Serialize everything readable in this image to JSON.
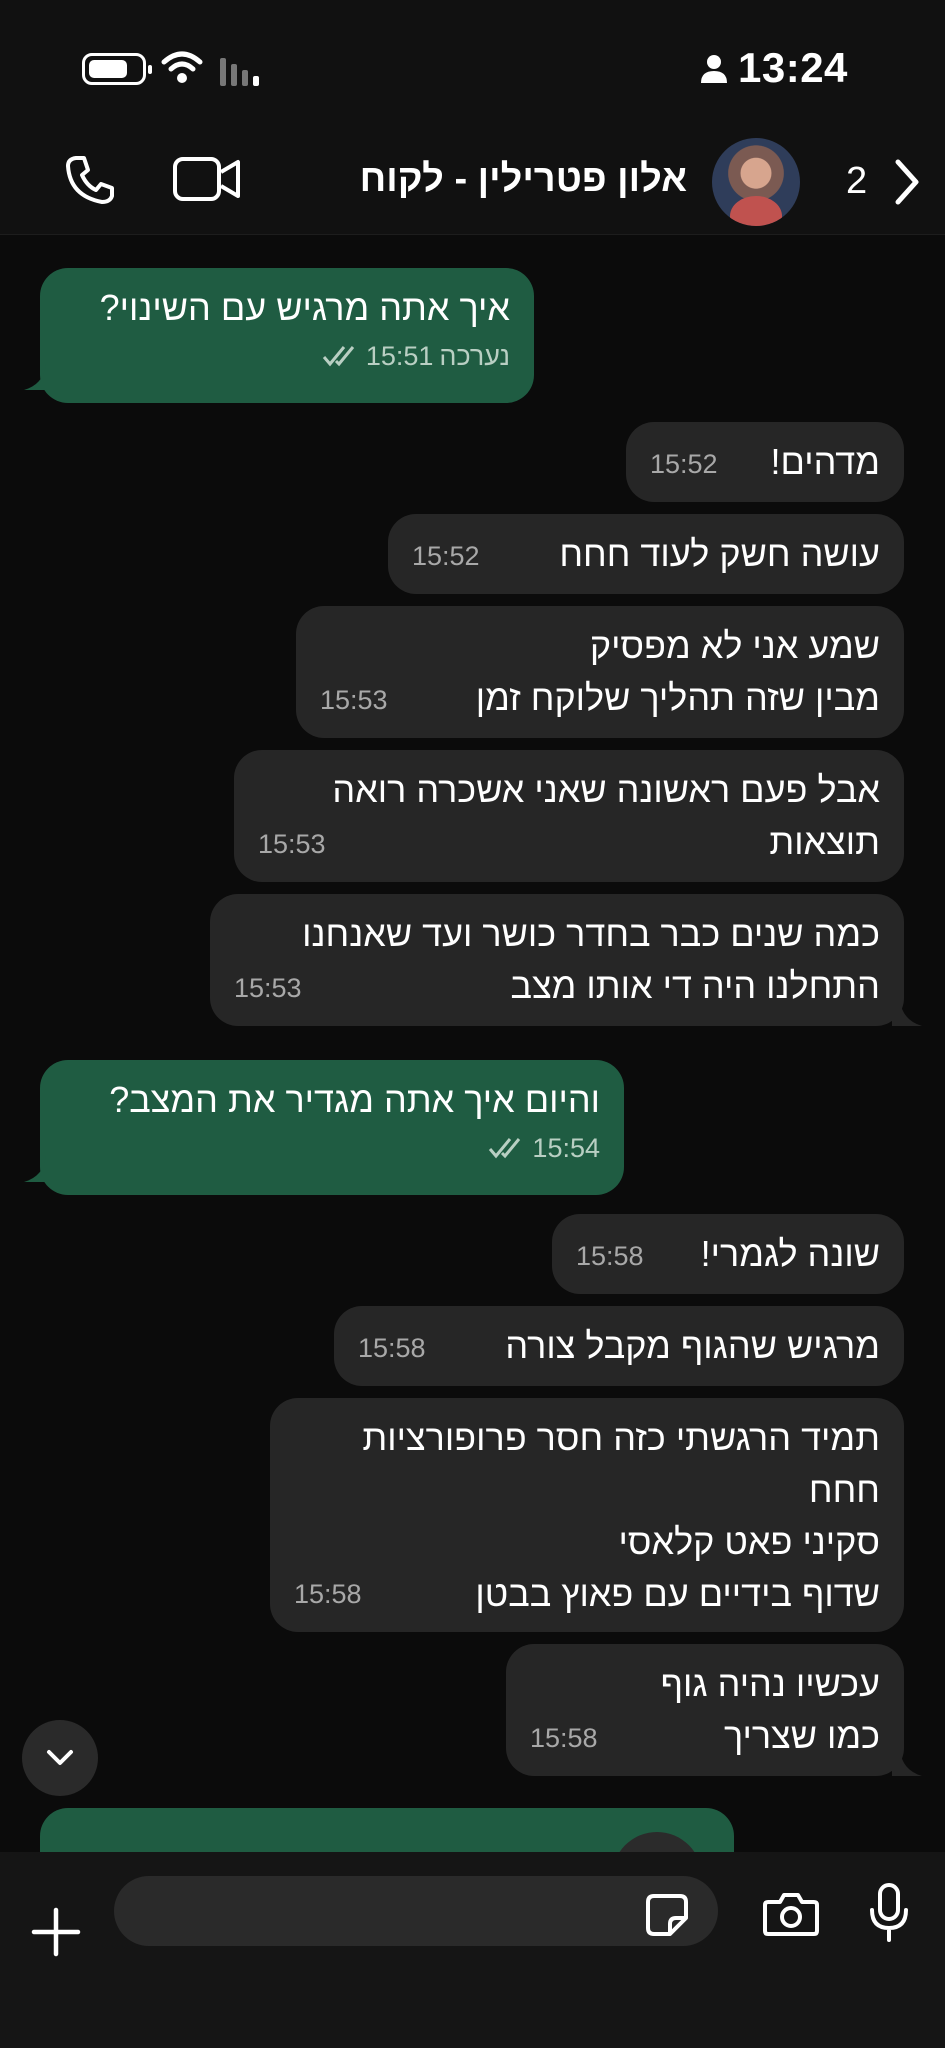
{
  "status_bar": {
    "time": "13:24",
    "icons": [
      "battery-icon",
      "wifi-icon",
      "signal-icon",
      "person-icon"
    ]
  },
  "header": {
    "contact_name": "אלון פטרילין - לקוח",
    "unread_count": "2",
    "icons": [
      "phone-icon",
      "video-call-icon",
      "back-chevron-icon"
    ]
  },
  "messages": [
    {
      "direction": "out",
      "text": "איך אתה מרגיש עם השינוי?",
      "time": "15:51",
      "edited_label": "נערכה",
      "status": "read"
    },
    {
      "direction": "in",
      "text": "מדהים!",
      "time": "15:52"
    },
    {
      "direction": "in",
      "text": "עושה חשק לעוד חחח",
      "time": "15:52"
    },
    {
      "direction": "in",
      "text": "שמע אני לא מפסיק\nמבין שזה תהליך שלוקח זמן",
      "time": "15:53"
    },
    {
      "direction": "in",
      "text": "אבל פעם ראשונה שאני אשכרה רואה\nתוצאות",
      "time": "15:53"
    },
    {
      "direction": "in",
      "text": "כמה שנים כבר בחדר כושר ועד שאנחנו\nהתחלנו היה די אותו מצב",
      "time": "15:53"
    },
    {
      "direction": "out",
      "text": "והיום איך אתה מגדיר את המצב?",
      "time": "15:54",
      "status": "read"
    },
    {
      "direction": "in",
      "text": "שונה לגמרי!",
      "time": "15:58"
    },
    {
      "direction": "in",
      "text": "מרגיש שהגוף מקבל צורה",
      "time": "15:58"
    },
    {
      "direction": "in",
      "text": "תמיד הרגשתי כזה חסר פרופורציות\nחחח\nסקיני פאט קלאסי\nשדוף בידיים עם פאוץ בבטן",
      "time": "15:58"
    },
    {
      "direction": "in",
      "text": "עכשיו נהיה גוף\nכמו שצריך",
      "time": "15:58"
    }
  ],
  "composer": {
    "input_value": "",
    "icons": [
      "plus-icon",
      "sticker-icon",
      "camera-icon",
      "microphone-icon"
    ]
  },
  "colors": {
    "background": "#0b0b0b",
    "incoming_bubble": "#262626",
    "outgoing_bubble": "#1f5c42",
    "bar": "#151515"
  }
}
